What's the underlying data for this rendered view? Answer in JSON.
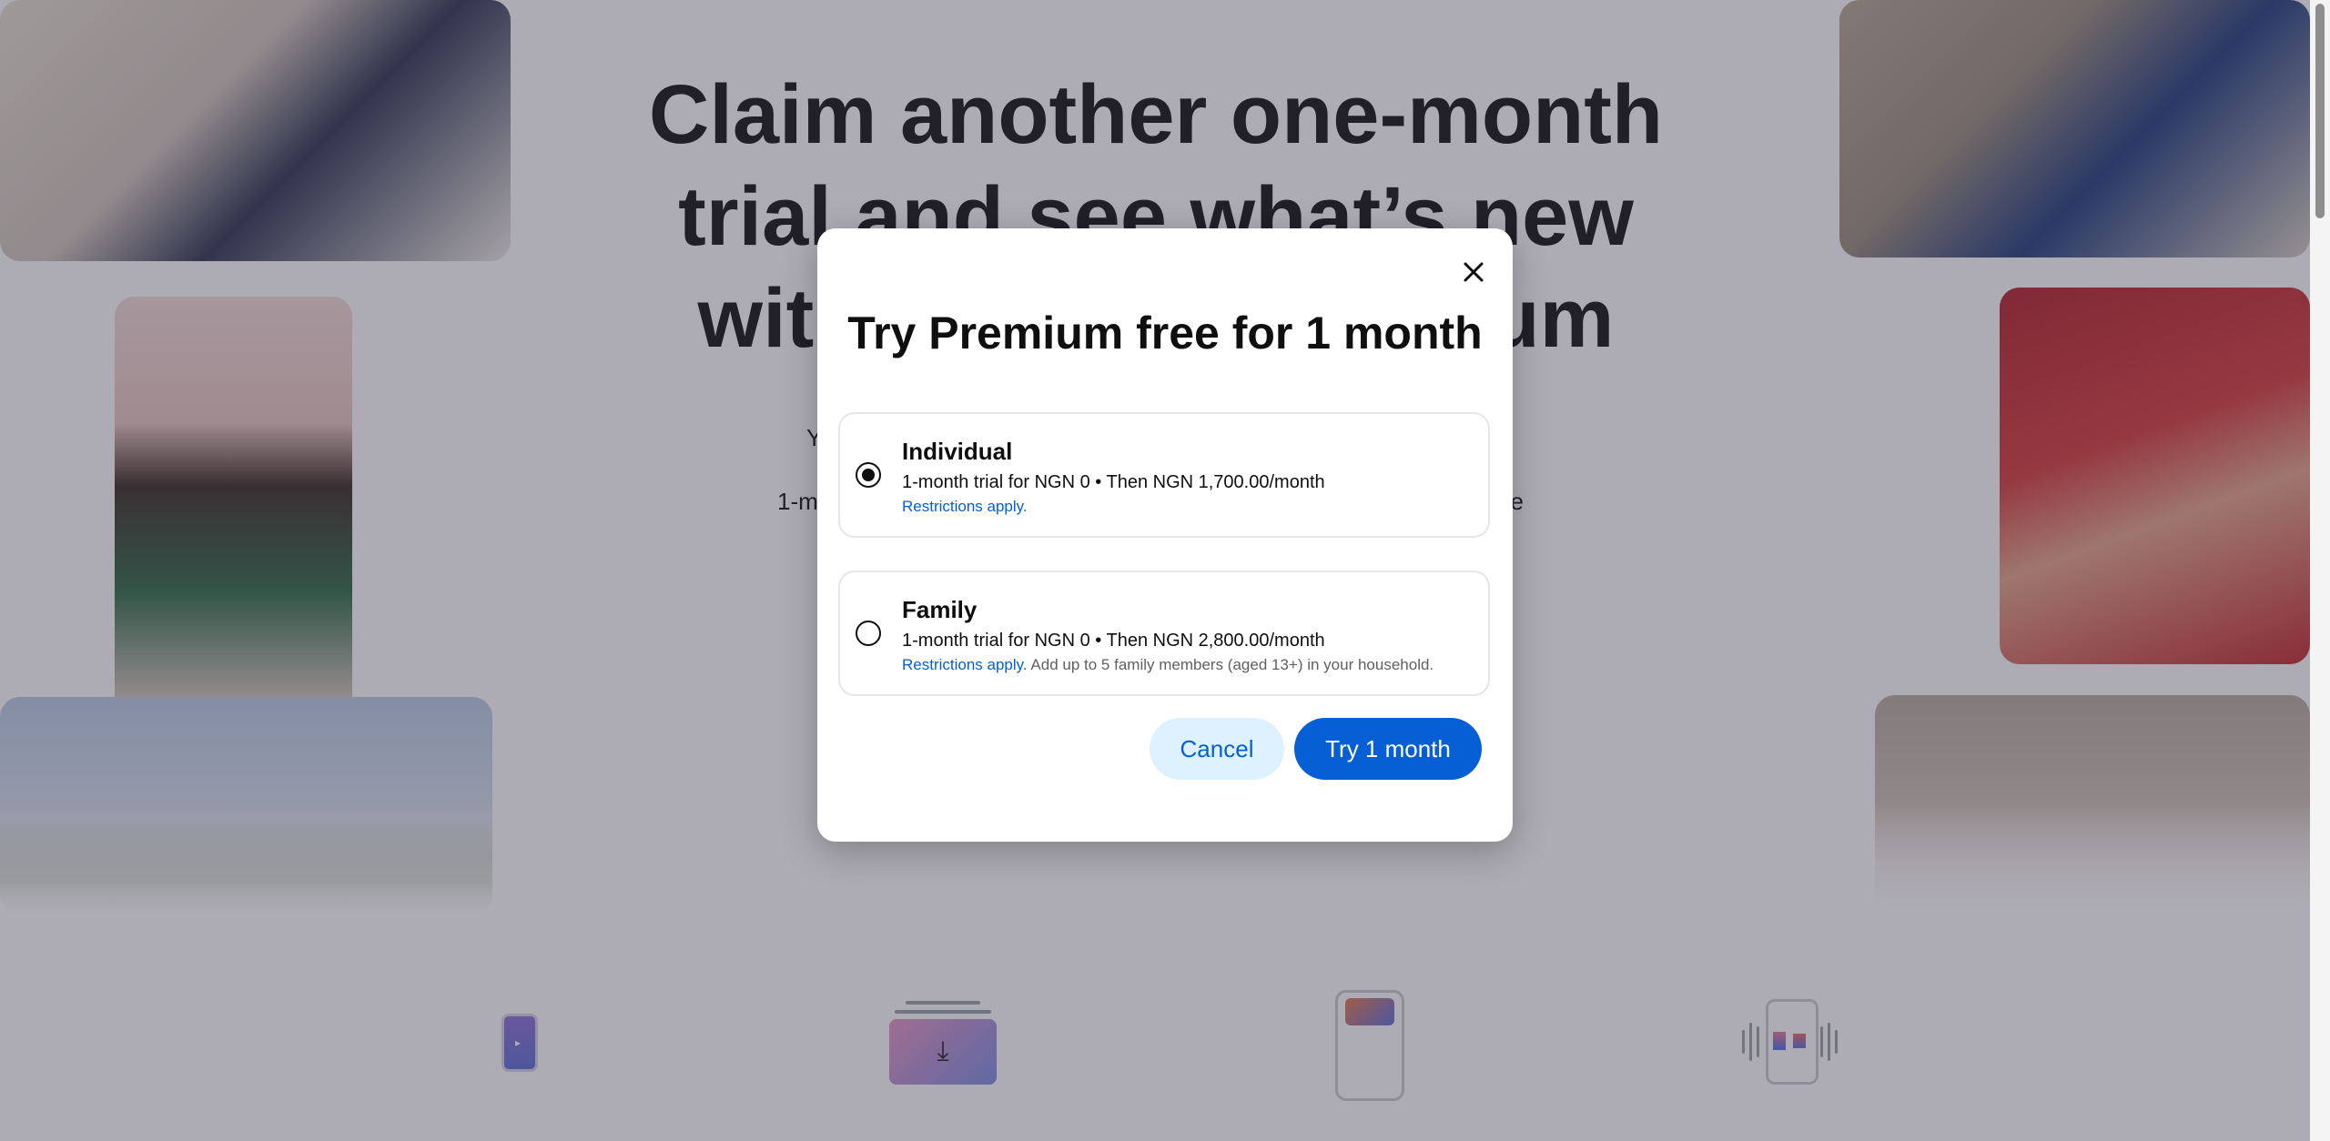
{
  "hero": {
    "title": "Claim another one-month trial and see what’s new with YouTube Premium",
    "subtitle_line1": "Y",
    "subtitle_line2_left": "1-m",
    "subtitle_line2_right": "e"
  },
  "features": {
    "play_glyph": "▸",
    "download_glyph": "⤓"
  },
  "dialog": {
    "close_icon": "close-icon",
    "title": "Try Premium free for 1 month",
    "plans": [
      {
        "name": "Individual",
        "price": "1-month trial for NGN 0 • Then NGN 1,700.00/month",
        "restrictions": "Restrictions apply.",
        "note": "",
        "selected": true
      },
      {
        "name": "Family",
        "price": "1-month trial for NGN 0 • Then NGN 2,800.00/month",
        "restrictions": "Restrictions apply.",
        "note": " Add up to 5 family members (aged 13+) in your household.",
        "selected": false
      }
    ],
    "cancel_label": "Cancel",
    "confirm_label": "Try 1 month"
  },
  "colors": {
    "accent": "#065fd4",
    "accent_light": "#def1ff",
    "overlay": "rgba(60,55,75,0.42)"
  }
}
